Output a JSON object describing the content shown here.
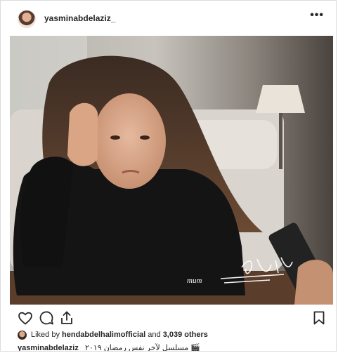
{
  "post": {
    "username": "yasminabdelaziz_",
    "more_label": "•••",
    "likes": {
      "liked_by_prefix": "Liked by ",
      "liked_by_user": "hendabdelhalimofficial",
      "and_text": " and ",
      "others_count": "3,039 others"
    },
    "caption": {
      "username": "yasminabdelaziz_",
      "text": "مسلسل لآخر نفس رمضان ٢٠١٩ 🎬"
    }
  },
  "icons": {
    "like": "heart-icon",
    "comment": "comment-icon",
    "share": "share-icon",
    "save": "bookmark-icon",
    "more": "more-options-icon"
  },
  "colors": {
    "text": "#262626",
    "border": "#dbdbdb"
  }
}
